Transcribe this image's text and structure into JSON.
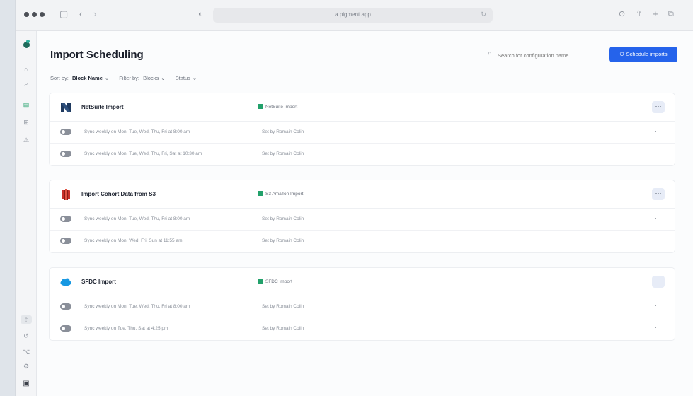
{
  "browser": {
    "url": "a.pigment.app",
    "icons": [
      "sidebar-toggle-icon",
      "back-icon",
      "forward-icon",
      "privacy-shield-icon",
      "reload-icon",
      "download-icon",
      "share-icon",
      "new-tab-icon",
      "tabs-icon"
    ]
  },
  "sidebar": {
    "top_icons": [
      "home-icon",
      "search-icon",
      "board-icon",
      "grid-icon",
      "warning-icon"
    ],
    "bottom_icons": [
      "import-icon",
      "history-icon",
      "flow-icon",
      "settings-icon",
      "user-icon"
    ]
  },
  "page": {
    "title": "Import Scheduling",
    "search_placeholder": "Search for configuration name...",
    "primary_button": "Schedule imports"
  },
  "filters": {
    "sort_label": "Sort by:",
    "sort_value": "Block Name",
    "filter_label": "Filter by:",
    "blocks": "Blocks",
    "status": "Status"
  },
  "groups": [
    {
      "name": "NetSuite Import",
      "type": "NetSuite Import",
      "logo": "netsuite-logo",
      "rows": [
        {
          "schedule": "Sync weekly on Mon, Tue, Wed, Thu, Fri at 8:00 am",
          "set_by": "Set by Romain Colin"
        },
        {
          "schedule": "Sync weekly on Mon, Tue, Wed, Thu, Fri, Sat at 10:30 am",
          "set_by": "Set by Romain Colin"
        }
      ]
    },
    {
      "name": "Import Cohort Data from S3",
      "type": "S3 Amazon Import",
      "logo": "amazon-s3-logo",
      "rows": [
        {
          "schedule": "Sync weekly on Mon, Tue, Wed, Thu, Fri at 8:00 am",
          "set_by": "Set by Romain Colin"
        },
        {
          "schedule": "Sync weekly on Mon, Wed, Fri, Sun at 11:55 am",
          "set_by": "Set by Romain Colin"
        }
      ]
    },
    {
      "name": "SFDC Import",
      "type": "SFDC Import",
      "logo": "salesforce-logo",
      "rows": [
        {
          "schedule": "Sync weekly on Mon, Tue, Wed, Thu, Fri at 8:00 am",
          "set_by": "Set by Romain Colin"
        },
        {
          "schedule": "Sync weekly on Tue, Thu, Sat at 4:25 pm",
          "set_by": "Set by Romain Colin"
        }
      ]
    }
  ],
  "colors": {
    "accent": "#2563eb",
    "import_type_icon": "#22a16b",
    "netsuite": "#1f3a5f",
    "amazon_s3": "#c7302a",
    "salesforce": "#1798e2"
  }
}
